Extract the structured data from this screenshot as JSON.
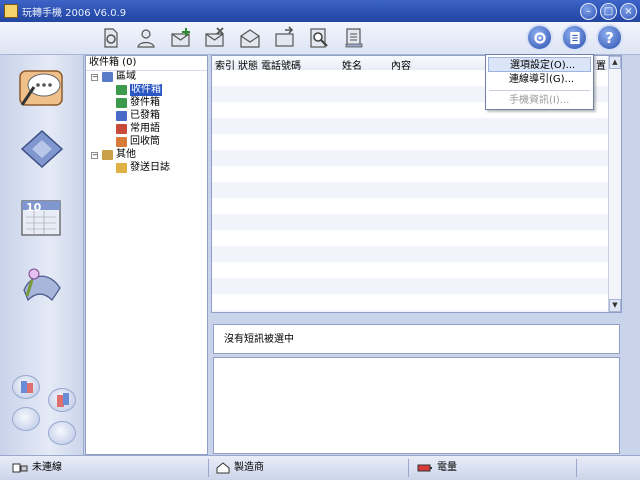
{
  "window": {
    "title": "玩轉手機 2006 V6.0.9"
  },
  "window_controls": [
    "minimize-icon",
    "maximize-icon",
    "close-icon"
  ],
  "toolbar": {
    "left_icons": [
      "phone-sync-icon",
      "contacts-icon",
      "new-message-icon",
      "delete-message-icon",
      "open-mail-icon",
      "forward-mail-icon",
      "search-icon",
      "export-icon"
    ],
    "right_icons": [
      "settings-gear-icon",
      "notes-icon",
      "help-icon"
    ]
  },
  "sidebar": {
    "items": [
      "messages-nav-icon",
      "phonebook-nav-icon",
      "calendar-nav-icon",
      "tools-nav-icon"
    ],
    "calendar_day": "10"
  },
  "folder_tree": {
    "header": "收件箱 (0)",
    "region_label": "區域",
    "folders": [
      "收件箱",
      "發件箱",
      "已發箱",
      "常用語",
      "回收筒"
    ],
    "other_label": "其他",
    "other_items": [
      "發送日誌"
    ]
  },
  "message_list": {
    "columns": [
      "索引",
      "狀態",
      "電話號碼",
      "姓名",
      "內容"
    ],
    "last_column_partial": "置"
  },
  "dropdown_menu": {
    "items": [
      "選項設定(O)...",
      "連線導引(G)...",
      "手機資訊(I)..."
    ]
  },
  "preview": {
    "status": "沒有短訊被選中"
  },
  "statusbar": {
    "connection": "未連線",
    "manufacturer": "製造商",
    "battery": "電量"
  },
  "colors": {
    "selection": "#2a57c4",
    "titlebar": "#2a4fb0"
  }
}
